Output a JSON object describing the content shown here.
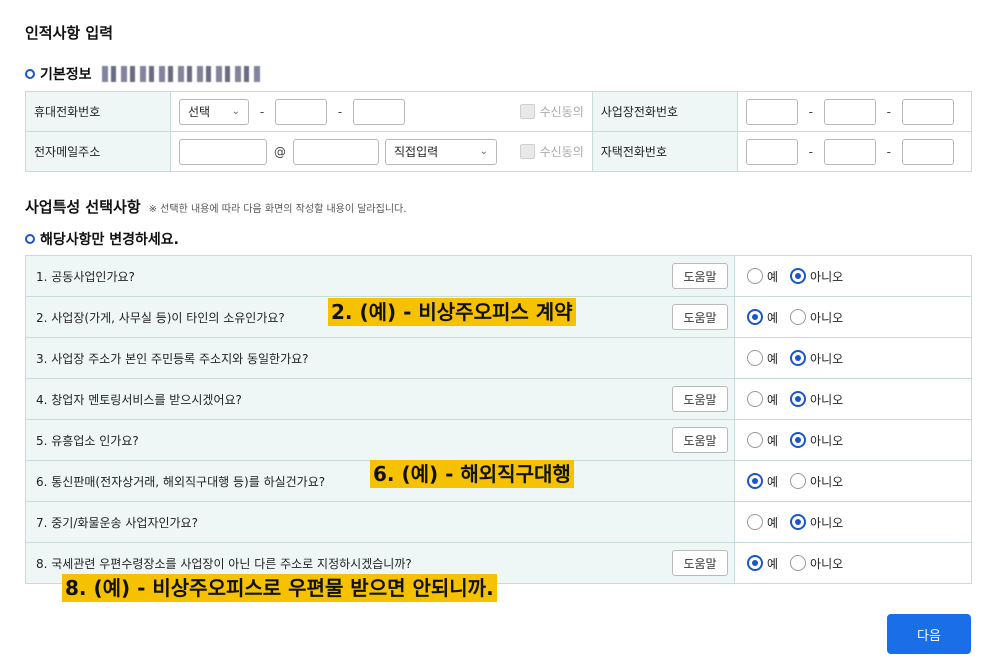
{
  "page_title": "인적사항 입력",
  "basic": {
    "heading": "기본정보",
    "mobile_label": "휴대전화번호",
    "mobile_select": "선택",
    "email_label": "전자메일주소",
    "email_at": "@",
    "email_domain_select": "직접입력",
    "consent_label": "수신동의",
    "biz_phone_label": "사업장전화번호",
    "home_phone_label": "자택전화번호",
    "dash": "-"
  },
  "features": {
    "heading": "사업특성 선택사항",
    "note": "※ 선택한 내용에 따라 다음 화면의 작성할 내용이 달라집니다.",
    "subheading": "해당사항만 변경하세요.",
    "help_label": "도움말",
    "yes_label": "예",
    "no_label": "아니오",
    "questions": [
      {
        "text": "1. 공동사업인가요?",
        "has_help": true,
        "selected": "no"
      },
      {
        "text": "2. 사업장(가게, 사무실 등)이 타인의 소유인가요?",
        "has_help": true,
        "selected": "yes"
      },
      {
        "text": "3. 사업장 주소가 본인 주민등록 주소지와 동일한가요?",
        "has_help": false,
        "selected": "no"
      },
      {
        "text": "4. 창업자 멘토링서비스를 받으시겠어요?",
        "has_help": true,
        "selected": "no"
      },
      {
        "text": "5. 유흥업소 인가요?",
        "has_help": true,
        "selected": "no"
      },
      {
        "text": "6. 통신판매(전자상거래, 해외직구대행 등)를 하실건가요?",
        "has_help": false,
        "selected": "yes"
      },
      {
        "text": "7. 중기/화물운송 사업자인가요?",
        "has_help": false,
        "selected": "no"
      },
      {
        "text": "8. 국세관련 우편수령장소를 사업장이 아닌 다른 주소로 지정하시겠습니까?",
        "has_help": true,
        "selected": "yes"
      }
    ]
  },
  "annotations": {
    "a2": "2. (예) - 비상주오피스 계약",
    "a6": "6. (예) - 해외직구대행",
    "a8": "8. (예) - 비상주오피스로 우편물 받으면 안되니까."
  },
  "next_label": "다음",
  "colors": {
    "accent": "#1a56c8",
    "button": "#1a6ee8",
    "highlight": "#f6c200",
    "header_bg": "#eef7f6"
  }
}
